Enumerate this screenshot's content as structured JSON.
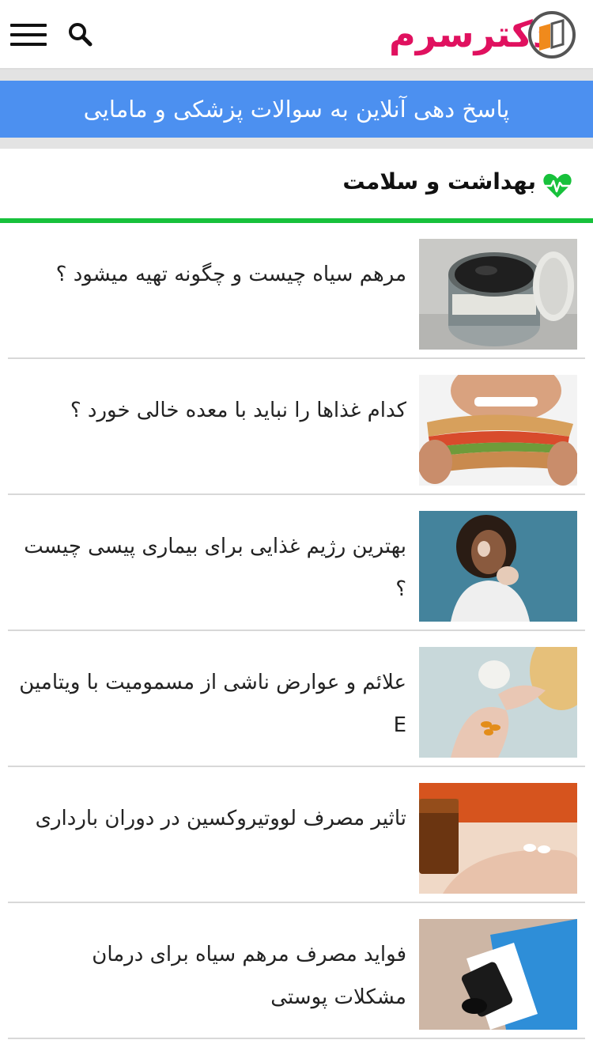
{
  "header": {
    "logo_text": "دکترسرم",
    "menu_icon": "hamburger-menu-icon",
    "search_icon": "search-icon"
  },
  "banner": {
    "text": "پاسخ دهی آنلاین به سوالات پزشکی و مامایی"
  },
  "section": {
    "title": "بهداشت و سلامت",
    "icon": "heart-pulse-icon"
  },
  "colors": {
    "banner_bg": "#4c90f0",
    "accent_green": "#17c13b",
    "logo_pink": "#e0115f"
  },
  "articles": [
    {
      "title": "مرهم سیاه چیست و چگونه تهیه میشود ؟",
      "thumb": "black-ointment-jar-image"
    },
    {
      "title": "کدام غذاها را نباید با معده خالی خورد ؟",
      "thumb": "man-eating-sandwich-image"
    },
    {
      "title": "بهترین رژیم غذایی برای بیماری پیسی چیست ؟",
      "thumb": "woman-with-vitiligo-image"
    },
    {
      "title": "علائم و عوارض ناشی از مسمومیت با ویتامین E",
      "thumb": "vitamin-capsules-hand-image"
    },
    {
      "title": "تاثیر مصرف لووتیروکسین در دوران بارداری",
      "thumb": "pills-on-hand-image"
    },
    {
      "title": "فواید مصرف مرهم سیاه برای درمان مشکلات پوستی",
      "thumb": "ointment-tube-image"
    }
  ]
}
